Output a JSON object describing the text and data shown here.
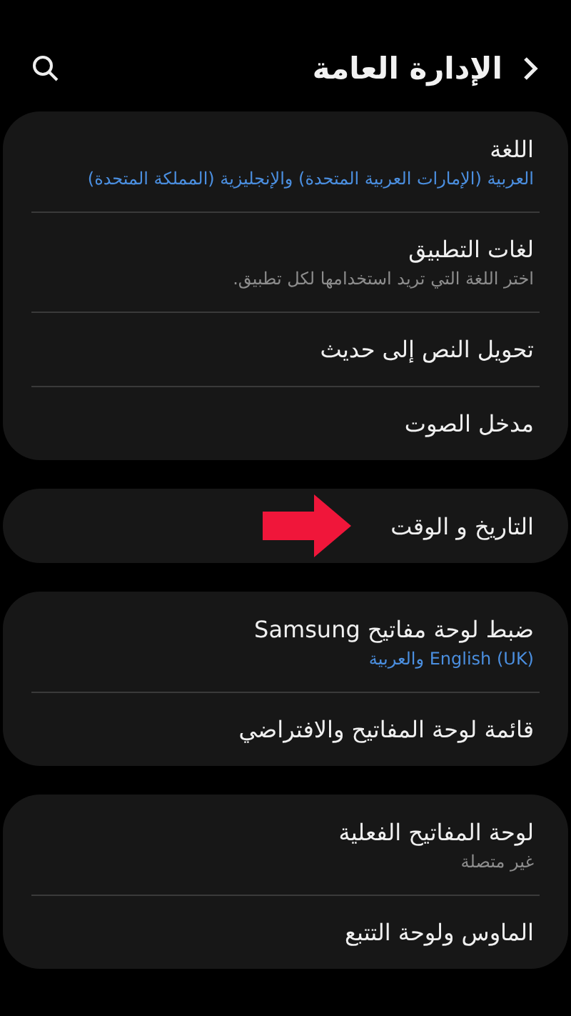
{
  "header": {
    "title": "الإدارة العامة"
  },
  "groups": [
    {
      "items": [
        {
          "title": "اللغة",
          "subtitle": "العربية (الإمارات العربية المتحدة) والإنجليزية (المملكة المتحدة)",
          "kind": "value",
          "marked": false
        },
        {
          "title": "لغات التطبيق",
          "subtitle": "اختر اللغة التي تريد استخدامها لكل تطبيق.",
          "kind": "hint",
          "marked": false
        },
        {
          "title": "تحويل النص إلى حديث",
          "marked": false
        },
        {
          "title": "مدخل الصوت",
          "marked": false
        }
      ]
    },
    {
      "items": [
        {
          "title": "التاريخ و الوقت",
          "marked": true
        }
      ]
    },
    {
      "items": [
        {
          "title": "ضبط لوحة مفاتيح Samsung",
          "subtitle": "English (UK) والعربية",
          "kind": "value",
          "marked": false
        },
        {
          "title": "قائمة لوحة المفاتيح والافتراضي",
          "marked": false
        }
      ]
    },
    {
      "items": [
        {
          "title": "لوحة المفاتيح الفعلية",
          "subtitle": "غير متصلة",
          "kind": "hint",
          "marked": false
        },
        {
          "title": "الماوس ولوحة التتبع",
          "marked": false
        }
      ]
    }
  ]
}
